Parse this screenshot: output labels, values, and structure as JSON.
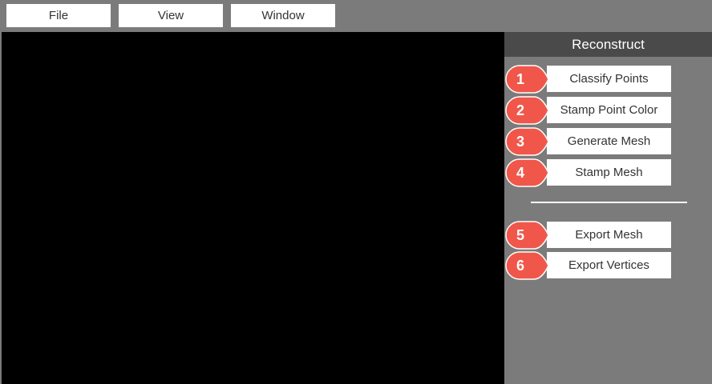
{
  "menubar": {
    "file_label": "File",
    "view_label": "View",
    "window_label": "Window"
  },
  "panel": {
    "title": "Reconstruct",
    "actions": [
      {
        "number": "1",
        "label": "Classify Points"
      },
      {
        "number": "2",
        "label": "Stamp Point Color"
      },
      {
        "number": "3",
        "label": "Generate Mesh"
      },
      {
        "number": "4",
        "label": "Stamp Mesh"
      },
      {
        "number": "5",
        "label": "Export Mesh"
      },
      {
        "number": "6",
        "label": "Export Vertices"
      }
    ]
  },
  "colors": {
    "badge": "#f0574a",
    "background": "#7b7b7b",
    "panel_header": "#4a4a4a",
    "viewport": "#000000"
  }
}
